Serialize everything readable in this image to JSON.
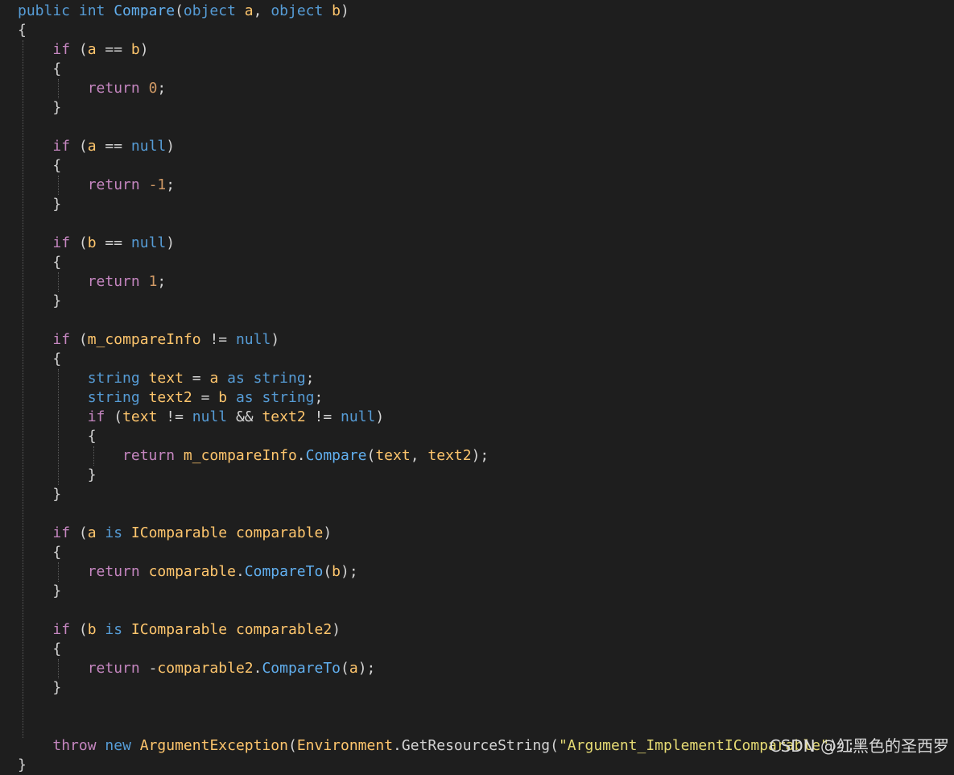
{
  "colors": {
    "background": "#1e1e1e",
    "keyword": "#569cd6",
    "control": "#c586c0",
    "identifier": "#ffc66d",
    "method": "#61afef",
    "number": "#d19a66",
    "string": "#e6db74",
    "plain": "#d4d4d4"
  },
  "code_lines": [
    [
      [
        "kw",
        "public "
      ],
      [
        "kw",
        "int "
      ],
      [
        "mt",
        "Compare"
      ],
      [
        "pl",
        "("
      ],
      [
        "kw",
        "object "
      ],
      [
        "id",
        "a"
      ],
      [
        "pl",
        ", "
      ],
      [
        "kw",
        "object "
      ],
      [
        "id",
        "b"
      ],
      [
        "pl",
        ")"
      ]
    ],
    [
      [
        "pl",
        "{"
      ]
    ],
    [
      [
        "pl",
        "    "
      ],
      [
        "ct",
        "if "
      ],
      [
        "pl",
        "("
      ],
      [
        "id",
        "a "
      ],
      [
        "pl",
        "== "
      ],
      [
        "id",
        "b"
      ],
      [
        "pl",
        ")"
      ]
    ],
    [
      [
        "pl",
        "    {"
      ]
    ],
    [
      [
        "pl",
        "        "
      ],
      [
        "ct",
        "return "
      ],
      [
        "nm",
        "0"
      ],
      [
        "pl",
        ";"
      ]
    ],
    [
      [
        "pl",
        "    }"
      ]
    ],
    [],
    [
      [
        "pl",
        "    "
      ],
      [
        "ct",
        "if "
      ],
      [
        "pl",
        "("
      ],
      [
        "id",
        "a "
      ],
      [
        "pl",
        "== "
      ],
      [
        "kw",
        "null"
      ],
      [
        "pl",
        ")"
      ]
    ],
    [
      [
        "pl",
        "    {"
      ]
    ],
    [
      [
        "pl",
        "        "
      ],
      [
        "ct",
        "return "
      ],
      [
        "nm",
        "-1"
      ],
      [
        "pl",
        ";"
      ]
    ],
    [
      [
        "pl",
        "    }"
      ]
    ],
    [],
    [
      [
        "pl",
        "    "
      ],
      [
        "ct",
        "if "
      ],
      [
        "pl",
        "("
      ],
      [
        "id",
        "b "
      ],
      [
        "pl",
        "== "
      ],
      [
        "kw",
        "null"
      ],
      [
        "pl",
        ")"
      ]
    ],
    [
      [
        "pl",
        "    {"
      ]
    ],
    [
      [
        "pl",
        "        "
      ],
      [
        "ct",
        "return "
      ],
      [
        "nm",
        "1"
      ],
      [
        "pl",
        ";"
      ]
    ],
    [
      [
        "pl",
        "    }"
      ]
    ],
    [],
    [
      [
        "pl",
        "    "
      ],
      [
        "ct",
        "if "
      ],
      [
        "pl",
        "("
      ],
      [
        "id",
        "m_compareInfo "
      ],
      [
        "pl",
        "!= "
      ],
      [
        "kw",
        "null"
      ],
      [
        "pl",
        ")"
      ]
    ],
    [
      [
        "pl",
        "    {"
      ]
    ],
    [
      [
        "pl",
        "        "
      ],
      [
        "kw",
        "string "
      ],
      [
        "id",
        "text "
      ],
      [
        "pl",
        "= "
      ],
      [
        "id",
        "a "
      ],
      [
        "kw",
        "as "
      ],
      [
        "kw",
        "string"
      ],
      [
        "pl",
        ";"
      ]
    ],
    [
      [
        "pl",
        "        "
      ],
      [
        "kw",
        "string "
      ],
      [
        "id",
        "text2 "
      ],
      [
        "pl",
        "= "
      ],
      [
        "id",
        "b "
      ],
      [
        "kw",
        "as "
      ],
      [
        "kw",
        "string"
      ],
      [
        "pl",
        ";"
      ]
    ],
    [
      [
        "pl",
        "        "
      ],
      [
        "ct",
        "if "
      ],
      [
        "pl",
        "("
      ],
      [
        "id",
        "text "
      ],
      [
        "pl",
        "!= "
      ],
      [
        "kw",
        "null "
      ],
      [
        "pl",
        "&& "
      ],
      [
        "id",
        "text2 "
      ],
      [
        "pl",
        "!= "
      ],
      [
        "kw",
        "null"
      ],
      [
        "pl",
        ")"
      ]
    ],
    [
      [
        "pl",
        "        {"
      ]
    ],
    [
      [
        "pl",
        "            "
      ],
      [
        "ct",
        "return "
      ],
      [
        "id",
        "m_compareInfo"
      ],
      [
        "pl",
        "."
      ],
      [
        "mt",
        "Compare"
      ],
      [
        "pl",
        "("
      ],
      [
        "id",
        "text"
      ],
      [
        "pl",
        ", "
      ],
      [
        "id",
        "text2"
      ],
      [
        "pl",
        ");"
      ]
    ],
    [
      [
        "pl",
        "        }"
      ]
    ],
    [
      [
        "pl",
        "    }"
      ]
    ],
    [],
    [
      [
        "pl",
        "    "
      ],
      [
        "ct",
        "if "
      ],
      [
        "pl",
        "("
      ],
      [
        "id",
        "a "
      ],
      [
        "kw",
        "is "
      ],
      [
        "id",
        "IComparable "
      ],
      [
        "id",
        "comparable"
      ],
      [
        "pl",
        ")"
      ]
    ],
    [
      [
        "pl",
        "    {"
      ]
    ],
    [
      [
        "pl",
        "        "
      ],
      [
        "ct",
        "return "
      ],
      [
        "id",
        "comparable"
      ],
      [
        "pl",
        "."
      ],
      [
        "mt",
        "CompareTo"
      ],
      [
        "pl",
        "("
      ],
      [
        "id",
        "b"
      ],
      [
        "pl",
        ");"
      ]
    ],
    [
      [
        "pl",
        "    }"
      ]
    ],
    [],
    [
      [
        "pl",
        "    "
      ],
      [
        "ct",
        "if "
      ],
      [
        "pl",
        "("
      ],
      [
        "id",
        "b "
      ],
      [
        "kw",
        "is "
      ],
      [
        "id",
        "IComparable "
      ],
      [
        "id",
        "comparable2"
      ],
      [
        "pl",
        ")"
      ]
    ],
    [
      [
        "pl",
        "    {"
      ]
    ],
    [
      [
        "pl",
        "        "
      ],
      [
        "ct",
        "return "
      ],
      [
        "pl",
        "-"
      ],
      [
        "id",
        "comparable2"
      ],
      [
        "pl",
        "."
      ],
      [
        "mt",
        "CompareTo"
      ],
      [
        "pl",
        "("
      ],
      [
        "id",
        "a"
      ],
      [
        "pl",
        ");"
      ]
    ],
    [
      [
        "pl",
        "    }"
      ]
    ],
    [],
    [],
    [
      [
        "pl",
        "    "
      ],
      [
        "ct",
        "throw "
      ],
      [
        "kw",
        "new "
      ],
      [
        "id",
        "ArgumentException"
      ],
      [
        "pl",
        "("
      ],
      [
        "id",
        "Environment"
      ],
      [
        "pl",
        "."
      ],
      [
        "pl",
        "GetResourceString"
      ],
      [
        "pl",
        "("
      ],
      [
        "st",
        "\"Argument_ImplementIComparable\""
      ],
      [
        "pl",
        "));"
      ]
    ],
    [
      [
        "pl",
        "}"
      ]
    ]
  ],
  "watermark": "CSDN @红黑色的圣西罗"
}
